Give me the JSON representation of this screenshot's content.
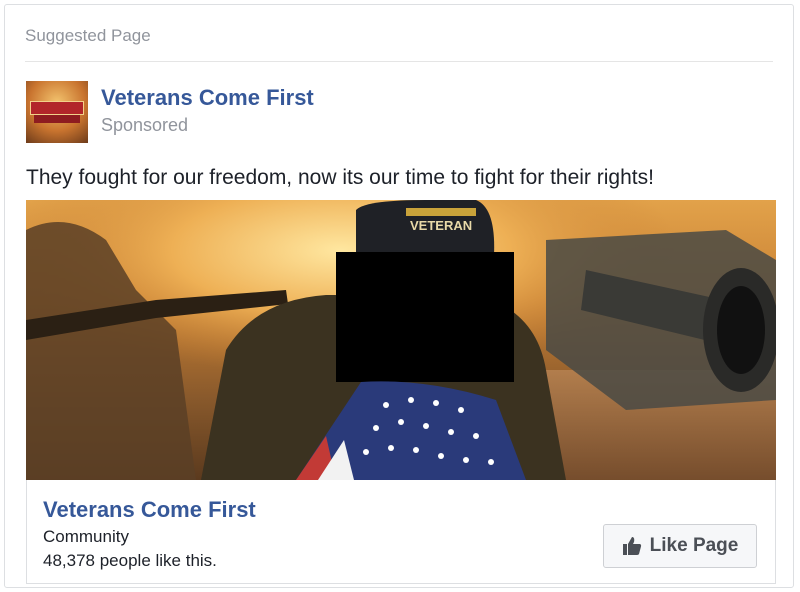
{
  "header": {
    "label": "Suggested Page"
  },
  "page": {
    "name": "Veterans Come First",
    "sponsored_label": "Sponsored"
  },
  "post": {
    "text": "They fought for our freedom, now its our time to fight for their rights!"
  },
  "image": {
    "cap_text": "VETERAN"
  },
  "footer": {
    "page_name": "Veterans Come First",
    "category": "Community",
    "likes_text": "48,378 people like this.",
    "like_button_label": "Like Page"
  },
  "colors": {
    "link": "#365899",
    "secondary_text": "#90949c",
    "body_text": "#1d2129"
  },
  "icons": {
    "like": "thumbs-up-icon"
  }
}
